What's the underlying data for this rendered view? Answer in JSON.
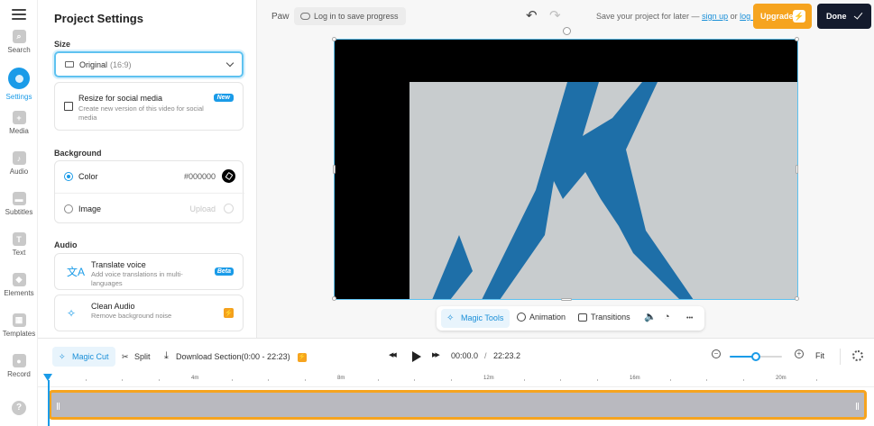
{
  "rail": {
    "items": [
      {
        "label": "Search",
        "icon": "search-icon",
        "glyph": "⌕"
      },
      {
        "label": "Settings",
        "icon": "settings-icon",
        "glyph": ""
      },
      {
        "label": "Media",
        "icon": "media-icon",
        "glyph": "+"
      },
      {
        "label": "Audio",
        "icon": "audio-icon",
        "glyph": "♪"
      },
      {
        "label": "Subtitles",
        "icon": "subtitles-icon",
        "glyph": "▬"
      },
      {
        "label": "Text",
        "icon": "text-icon",
        "glyph": "T"
      },
      {
        "label": "Elements",
        "icon": "elements-icon",
        "glyph": "◆"
      },
      {
        "label": "Templates",
        "icon": "templates-icon",
        "glyph": "▦"
      },
      {
        "label": "Record",
        "icon": "record-icon",
        "glyph": "●"
      }
    ],
    "active": "Settings",
    "help_glyph": "?"
  },
  "panel": {
    "title": "Project Settings",
    "size_label": "Size",
    "size_value": "Original",
    "size_ratio": "(16:9)",
    "resize_title": "Resize for social media",
    "resize_desc": "Create new version of this video for social media",
    "resize_badge": "New",
    "background_label": "Background",
    "color_label": "Color",
    "color_value": "#000000",
    "image_label": "Image",
    "upload_label": "Upload",
    "audio_label": "Audio",
    "translate_title": "Translate voice",
    "translate_desc": "Add voice translations in multi-languages",
    "translate_badge": "Beta",
    "clean_title": "Clean Audio",
    "clean_desc": "Remove background noise",
    "translate_glyph": "文A",
    "clean_glyph": "✧"
  },
  "topbar": {
    "project_name": "Paw",
    "login_chip": "Log in to save progress",
    "undo_glyph": "↶",
    "redo_glyph": "↷",
    "save_prefix": "Save your project for later —",
    "signup": "sign up",
    "or": "or",
    "login": "log in",
    "upgrade": "Upgrade",
    "done": "Done",
    "bolt_glyph": "⚡"
  },
  "context_bar": {
    "magic_tools": "Magic Tools",
    "animation": "Animation",
    "transitions": "Transitions",
    "magic_glyph": "✧",
    "volume_glyph": "🔈",
    "speed_glyph": "◔",
    "more_glyph": "•••"
  },
  "timeline_toolbar": {
    "magic_cut": "Magic Cut",
    "split": "Split",
    "download": "Download Section",
    "download_range": "(0:00 - 22:23)",
    "magic_glyph": "✧",
    "split_glyph": "✂",
    "download_glyph": "⤓",
    "rewind_glyph": "◀◀",
    "forward_glyph": "▶▶",
    "current_time": "00:00.0",
    "separator": "/",
    "total_time": "22:23.2",
    "zoom_out": "−",
    "zoom_in": "+",
    "zoom_level": 0.5,
    "fit": "Fit"
  },
  "timeline": {
    "ruler_labels": [
      "4m",
      "8m",
      "12m",
      "16m",
      "20m"
    ],
    "playhead_time": "00:00.0"
  },
  "colors": {
    "accent": "#1a9be8",
    "upgrade": "#f6a41f",
    "done": "#141b2d",
    "clip_border": "#f6a41f",
    "mountain": "#1e6fa8",
    "sky": "#c8ccce"
  }
}
